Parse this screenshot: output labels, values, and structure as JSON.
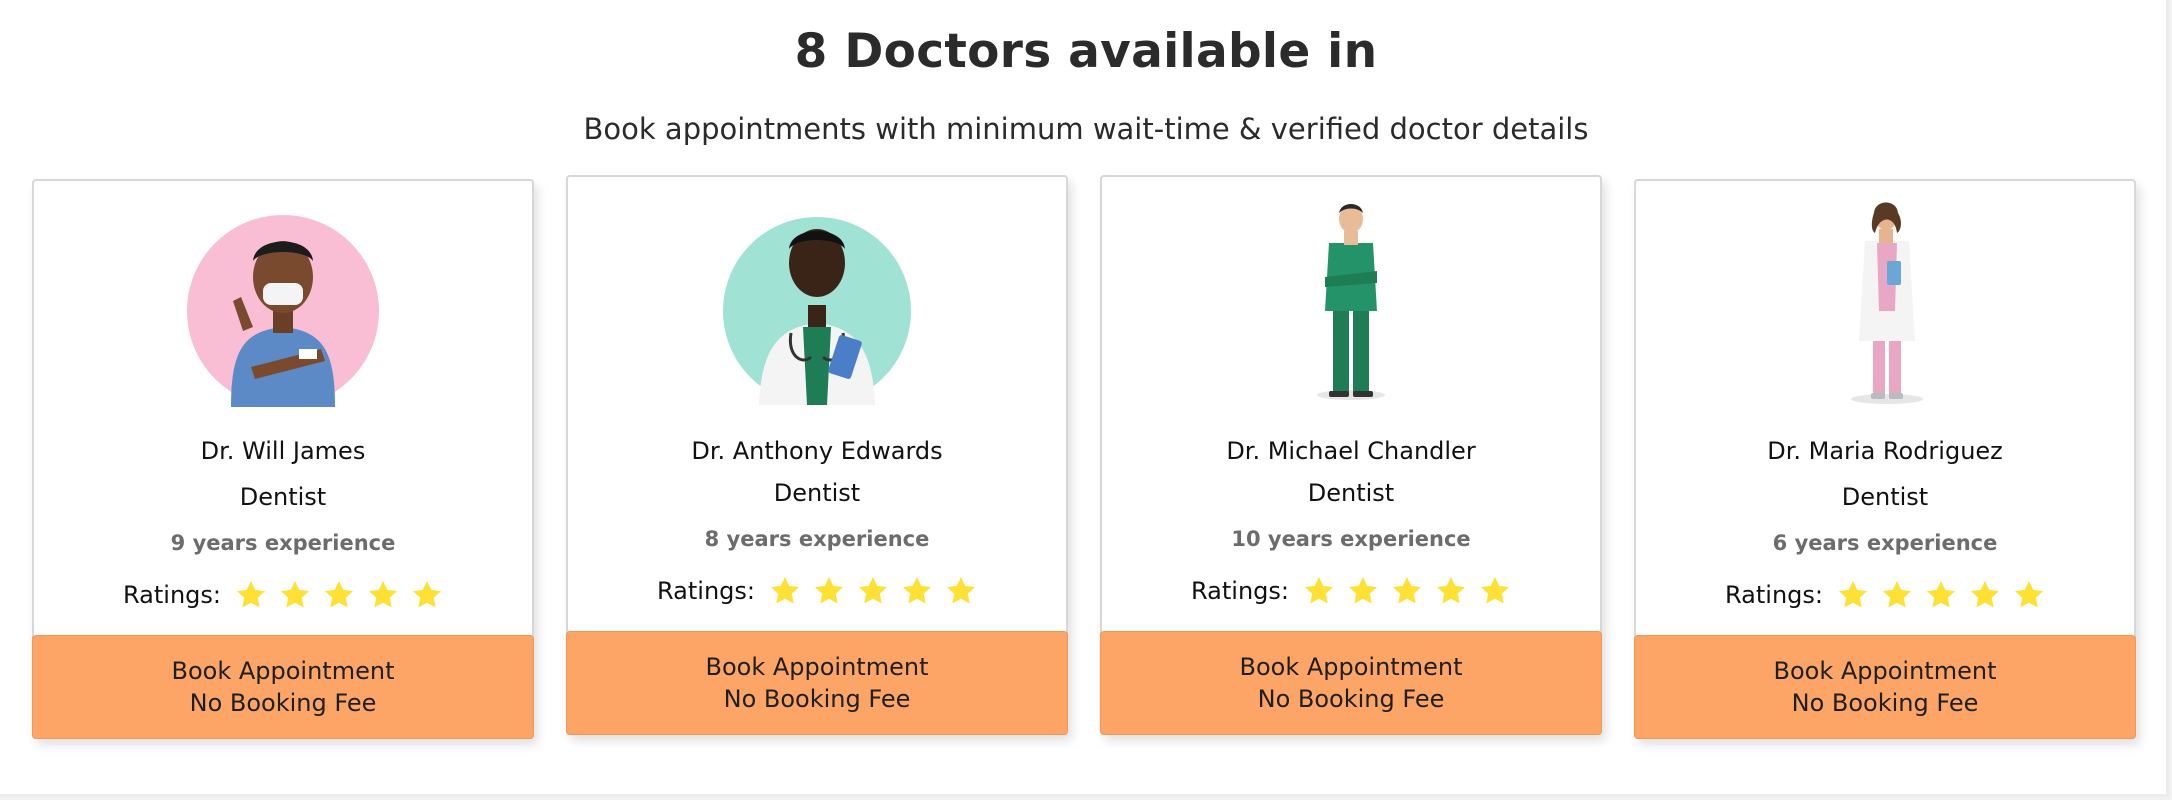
{
  "header": {
    "title": "8 Doctors available in",
    "subtitle": "Book appointments with minimum wait-time & verified doctor details"
  },
  "colors": {
    "button_bg": "#fda567",
    "star": "#ffe135",
    "pink_circle": "#f9bdd4",
    "teal_circle": "#a0e2d3"
  },
  "doctors": [
    {
      "name": "Dr. Will James",
      "specialty": "Dentist",
      "experience": "9 years experience",
      "ratings_label": "Ratings:",
      "stars": 5,
      "button_line1": "Book Appointment",
      "button_line2": "No Booking Fee",
      "avatar_icon": "doctor-in-blue-scrubs-with-mask"
    },
    {
      "name": "Dr. Anthony Edwards",
      "specialty": "Dentist",
      "experience": "8 years experience",
      "ratings_label": "Ratings:",
      "stars": 5,
      "button_line1": "Book Appointment",
      "button_line2": "No Booking Fee",
      "avatar_icon": "doctor-in-white-coat-with-stethoscope"
    },
    {
      "name": "Dr. Michael Chandler",
      "specialty": "Dentist",
      "experience": "10 years experience",
      "ratings_label": "Ratings:",
      "stars": 5,
      "button_line1": "Book Appointment",
      "button_line2": "No Booking Fee",
      "avatar_icon": "doctor-in-green-scrubs-full-body"
    },
    {
      "name": "Dr. Maria Rodriguez",
      "specialty": "Dentist",
      "experience": "6 years experience",
      "ratings_label": "Ratings:",
      "stars": 5,
      "button_line1": "Book Appointment",
      "button_line2": "No Booking Fee",
      "avatar_icon": "female-doctor-in-white-coat-full-body"
    }
  ]
}
